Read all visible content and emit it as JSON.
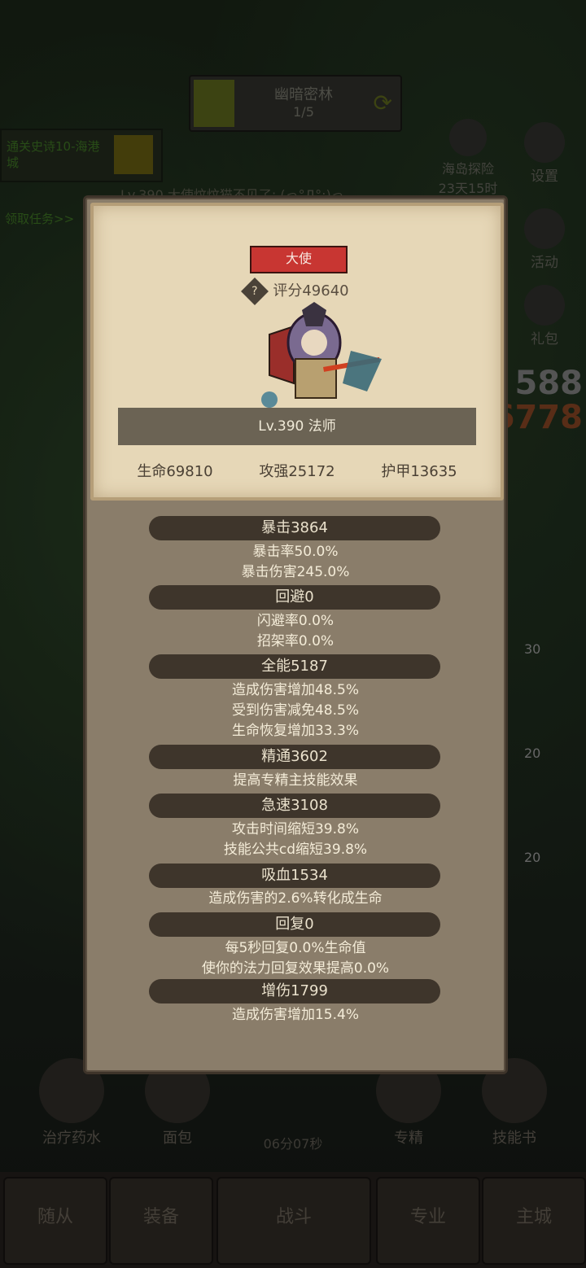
{
  "background": {
    "stage_name": "幽暗密林",
    "stage_progress": "1/5",
    "quest_title": "通关史诗10-海港城",
    "quest_link": "领取任务>>",
    "chat_line": "Lv.390 大使炆炆猫不见了: (っ°Д°;)っ",
    "island_label": "海岛探险",
    "island_timer": "23天15时",
    "side_buttons": [
      "设置",
      "活动",
      "礼包"
    ],
    "big_num_1": "588",
    "big_num_2": "6778",
    "tools": [
      "治疗药水",
      "面包",
      "专精",
      "技能书"
    ],
    "timer": "06分07秒",
    "tabs": [
      "随从",
      "装备",
      "战斗",
      "专业",
      "主城"
    ],
    "item_badges": [
      "30",
      "20",
      "20"
    ]
  },
  "card": {
    "title": "大使",
    "score": "评分49640",
    "level_class": "Lv.390 法师",
    "stats": [
      "生命69810",
      "攻强25172",
      "护甲13635"
    ]
  },
  "sections": [
    {
      "header": "暴击3864",
      "lines": [
        "暴击率50.0%",
        "暴击伤害245.0%"
      ]
    },
    {
      "header": "回避0",
      "lines": [
        "闪避率0.0%",
        "招架率0.0%"
      ]
    },
    {
      "header": "全能5187",
      "lines": [
        "造成伤害增加48.5%",
        "受到伤害减免48.5%",
        "生命恢复增加33.3%"
      ]
    },
    {
      "header": "精通3602",
      "lines": [
        "提高专精主技能效果"
      ]
    },
    {
      "header": "急速3108",
      "lines": [
        "攻击时间缩短39.8%",
        "技能公共cd缩短39.8%"
      ]
    },
    {
      "header": "吸血1534",
      "lines": [
        "造成伤害的2.6%转化成生命"
      ]
    },
    {
      "header": "回复0",
      "lines": [
        "每5秒回复0.0%生命值",
        "使你的法力回复效果提高0.0%"
      ]
    },
    {
      "header": "增伤1799",
      "lines": [
        "造成伤害增加15.4%"
      ]
    }
  ],
  "colors": {
    "title_badge": "#c83632",
    "card_bg": "#e6d7b7",
    "modal_bg": "#8a7d6a",
    "section_bar": "#3e352b"
  }
}
